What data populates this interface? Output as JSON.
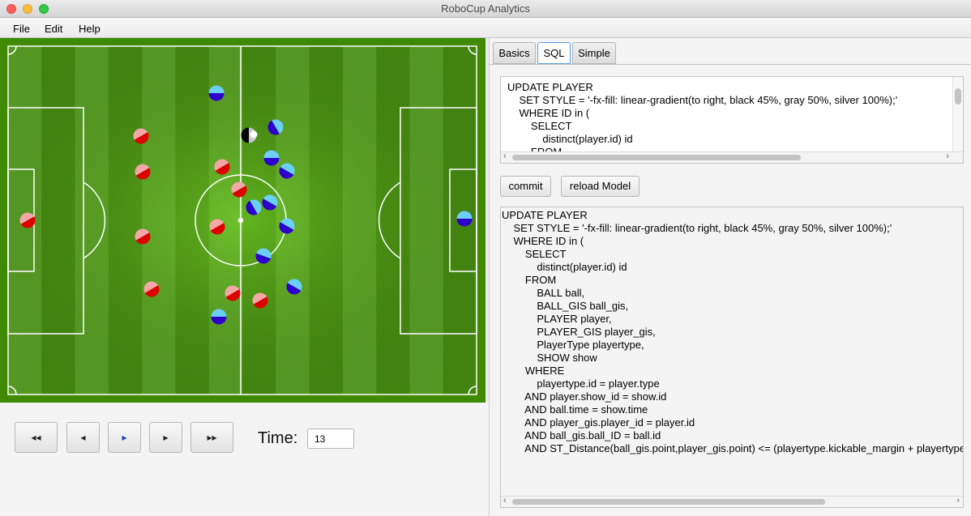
{
  "window": {
    "title": "RoboCup Analytics"
  },
  "menu": [
    {
      "label": "File"
    },
    {
      "label": "Edit"
    },
    {
      "label": "Help"
    }
  ],
  "tabs": [
    {
      "label": "Basics"
    },
    {
      "label": "SQL"
    },
    {
      "label": "Simple"
    }
  ],
  "active_tab": "SQL",
  "sql_editor": {
    "text": "UPDATE PLAYER\n    SET STYLE = '-fx-fill: linear-gradient(to right, black 45%, gray 50%, silver 100%);'\n    WHERE ID in (\n        SELECT\n            distinct(player.id) id\n        FROM"
  },
  "buttons": {
    "commit": "commit",
    "reload": "reload Model"
  },
  "query_output": {
    "text": "UPDATE PLAYER\n    SET STYLE = '-fx-fill: linear-gradient(to right, black 45%, gray 50%, silver 100%);'\n    WHERE ID in (\n        SELECT\n            distinct(player.id) id\n        FROM\n            BALL ball,\n            BALL_GIS ball_gis,\n            PLAYER player,\n            PLAYER_GIS player_gis,\n            PlayerType playertype,\n            SHOW show\n        WHERE\n            playertype.id = player.type\n        AND player.show_id = show.id\n        AND ball.time = show.time\n        AND player_gis.player_id = player.id\n        AND ball_gis.ball_ID = ball.id\n        AND ST_Distance(ball_gis.point,player_gis.point) <= (playertype.kickable_margin + playertype"
  },
  "playback": {
    "rewind_label": "◂◂",
    "step_back_label": "◂",
    "play_label": "▸",
    "step_forward_label": "▸",
    "fast_forward_label": "▸▸",
    "time_label": "Time:",
    "time_value": "13"
  },
  "colors": {
    "team_red_a": "#dd0000",
    "team_red_b": "#f5a6a6",
    "team_blue_a": "#2d00cc",
    "team_blue_b": "#6ad0f8",
    "highlight_a": "#000000",
    "highlight_b": "#c8c8c8",
    "pitch_light": "#64b22a",
    "pitch_dark": "#4d9a12",
    "pitch_border": "#3f8a00"
  },
  "field_players": [
    {
      "team": "red",
      "angle": -30
    },
    {
      "team": "red",
      "angle": -30
    },
    {
      "team": "red",
      "angle": -30
    },
    {
      "team": "red",
      "angle": -30
    },
    {
      "team": "red",
      "angle": -30
    },
    {
      "team": "red",
      "angle": -30
    },
    {
      "team": "red",
      "angle": -30
    },
    {
      "team": "red",
      "angle": -30
    },
    {
      "team": "red",
      "angle": -30
    },
    {
      "team": "red",
      "angle": -30
    },
    {
      "team": "red",
      "angle": -30
    },
    {
      "team": "blue",
      "angle": 0
    },
    {
      "team": "blue",
      "angle": 60
    },
    {
      "team": "blue",
      "angle": 0
    },
    {
      "team": "blue",
      "angle": 30
    },
    {
      "team": "blue",
      "angle": 60
    },
    {
      "team": "blue",
      "angle": 30
    },
    {
      "team": "blue",
      "angle": 30
    },
    {
      "team": "blue",
      "angle": 20
    },
    {
      "team": "blue",
      "angle": 30
    },
    {
      "team": "blue",
      "angle": 0
    },
    {
      "team": "blue",
      "angle": 0
    },
    {
      "team": "highlight",
      "angle": 90
    }
  ]
}
